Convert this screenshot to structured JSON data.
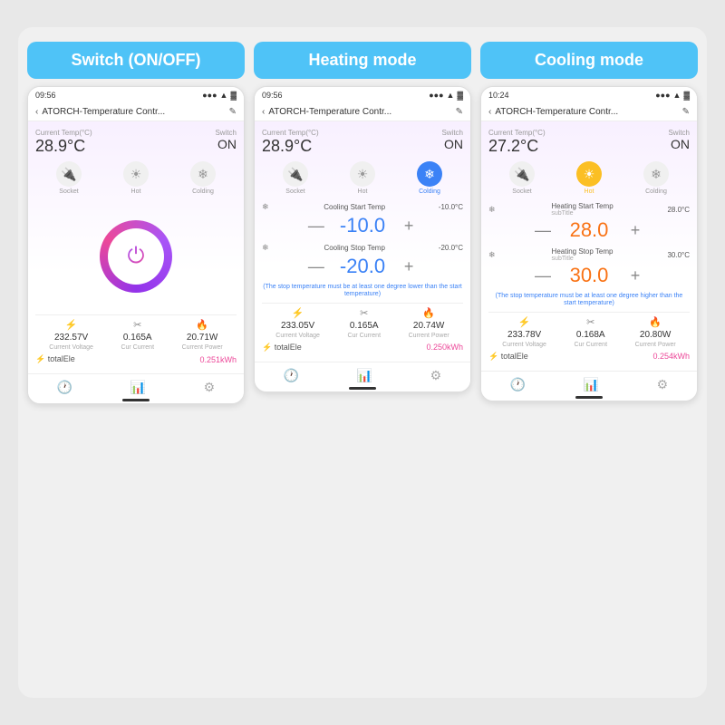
{
  "background": "#e8e8e8",
  "phones": [
    {
      "id": "switch",
      "mode_label": "Switch (ON/OFF)",
      "status_bar": {
        "time": "09:56",
        "signal": "●●●",
        "wifi": "▲",
        "battery": "▓"
      },
      "nav_title": "ATORCH-Temperature Contr...",
      "current_temp_label": "Current Temp(°C)",
      "current_temp": "28.9°C",
      "switch_label": "Switch",
      "switch_value": "ON",
      "icons": [
        {
          "label": "Socket",
          "symbol": "🔌",
          "active": false
        },
        {
          "label": "Hot",
          "symbol": "☀",
          "active": false
        },
        {
          "label": "Colding",
          "symbol": "❄",
          "active": false
        }
      ],
      "power_button": true,
      "stats": [
        {
          "label": "Current Voltage",
          "icon": "⚡",
          "value": "232.57V"
        },
        {
          "label": "Cur Current",
          "icon": "✂",
          "value": "0.165A"
        },
        {
          "label": "Current Power",
          "icon": "🔥",
          "value": "20.71W"
        }
      ],
      "total_label": "totalEle",
      "total_value": "0.251kWh",
      "bottom_nav": [
        "🕐",
        "📊",
        "⚙"
      ]
    },
    {
      "id": "heating",
      "mode_label": "Heating mode",
      "status_bar": {
        "time": "09:56",
        "signal": "●●●",
        "wifi": "▲",
        "battery": "▓"
      },
      "nav_title": "ATORCH-Temperature Contr...",
      "current_temp_label": "Current Temp(°C)",
      "current_temp": "28.9°C",
      "switch_label": "Switch",
      "switch_value": "ON",
      "icons": [
        {
          "label": "Socket",
          "symbol": "🔌",
          "active": false
        },
        {
          "label": "Hot",
          "symbol": "☀",
          "active": false
        },
        {
          "label": "Colding",
          "symbol": "❄",
          "active": true,
          "color": "blue"
        }
      ],
      "controls": [
        {
          "label": "Cooling Start Temp",
          "subtitle": "",
          "value": "-10.0",
          "side_value": "-10.0°C",
          "color": "blue"
        },
        {
          "label": "Cooling Stop Temp",
          "subtitle": "",
          "value": "-20.0",
          "side_value": "-20.0°C",
          "color": "blue"
        }
      ],
      "warning": "(The stop temperature must be at least one degree lower than the start temperature)",
      "stats": [
        {
          "label": "Current Voltage",
          "icon": "⚡",
          "value": "233.05V"
        },
        {
          "label": "Cur Current",
          "icon": "✂",
          "value": "0.165A"
        },
        {
          "label": "Current Power",
          "icon": "🔥",
          "value": "20.74W"
        }
      ],
      "total_label": "totalEle",
      "total_value": "0.250kWh",
      "bottom_nav": [
        "🕐",
        "📊",
        "⚙"
      ]
    },
    {
      "id": "cooling",
      "mode_label": "Cooling mode",
      "status_bar": {
        "time": "10:24",
        "signal": "●●●",
        "wifi": "▲",
        "battery": "▓"
      },
      "nav_title": "ATORCH-Temperature Contr...",
      "current_temp_label": "Current Temp(°C)",
      "current_temp": "27.2°C",
      "switch_label": "Switch",
      "switch_value": "ON",
      "icons": [
        {
          "label": "Socket",
          "symbol": "🔌",
          "active": false
        },
        {
          "label": "Hot",
          "symbol": "☀",
          "active": true,
          "color": "yellow"
        },
        {
          "label": "Colding",
          "symbol": "❄",
          "active": false
        }
      ],
      "controls": [
        {
          "label": "Heating Start Temp",
          "subtitle": "subTitle",
          "value": "28.0",
          "side_value": "28.0°C",
          "color": "orange"
        },
        {
          "label": "Heating Stop Temp",
          "subtitle": "subTitle",
          "value": "30.0",
          "side_value": "30.0°C",
          "color": "orange"
        }
      ],
      "warning": "(The stop temperature must be at least one degree higher than the start temperature)",
      "stats": [
        {
          "label": "Current Voltage",
          "icon": "⚡",
          "value": "233.78V"
        },
        {
          "label": "Cur Current",
          "icon": "✂",
          "value": "0.168A"
        },
        {
          "label": "Current Power",
          "icon": "🔥",
          "value": "20.80W"
        }
      ],
      "total_label": "totalEle",
      "total_value": "0.254kWh",
      "bottom_nav": [
        "🕐",
        "📊",
        "⚙"
      ]
    }
  ]
}
